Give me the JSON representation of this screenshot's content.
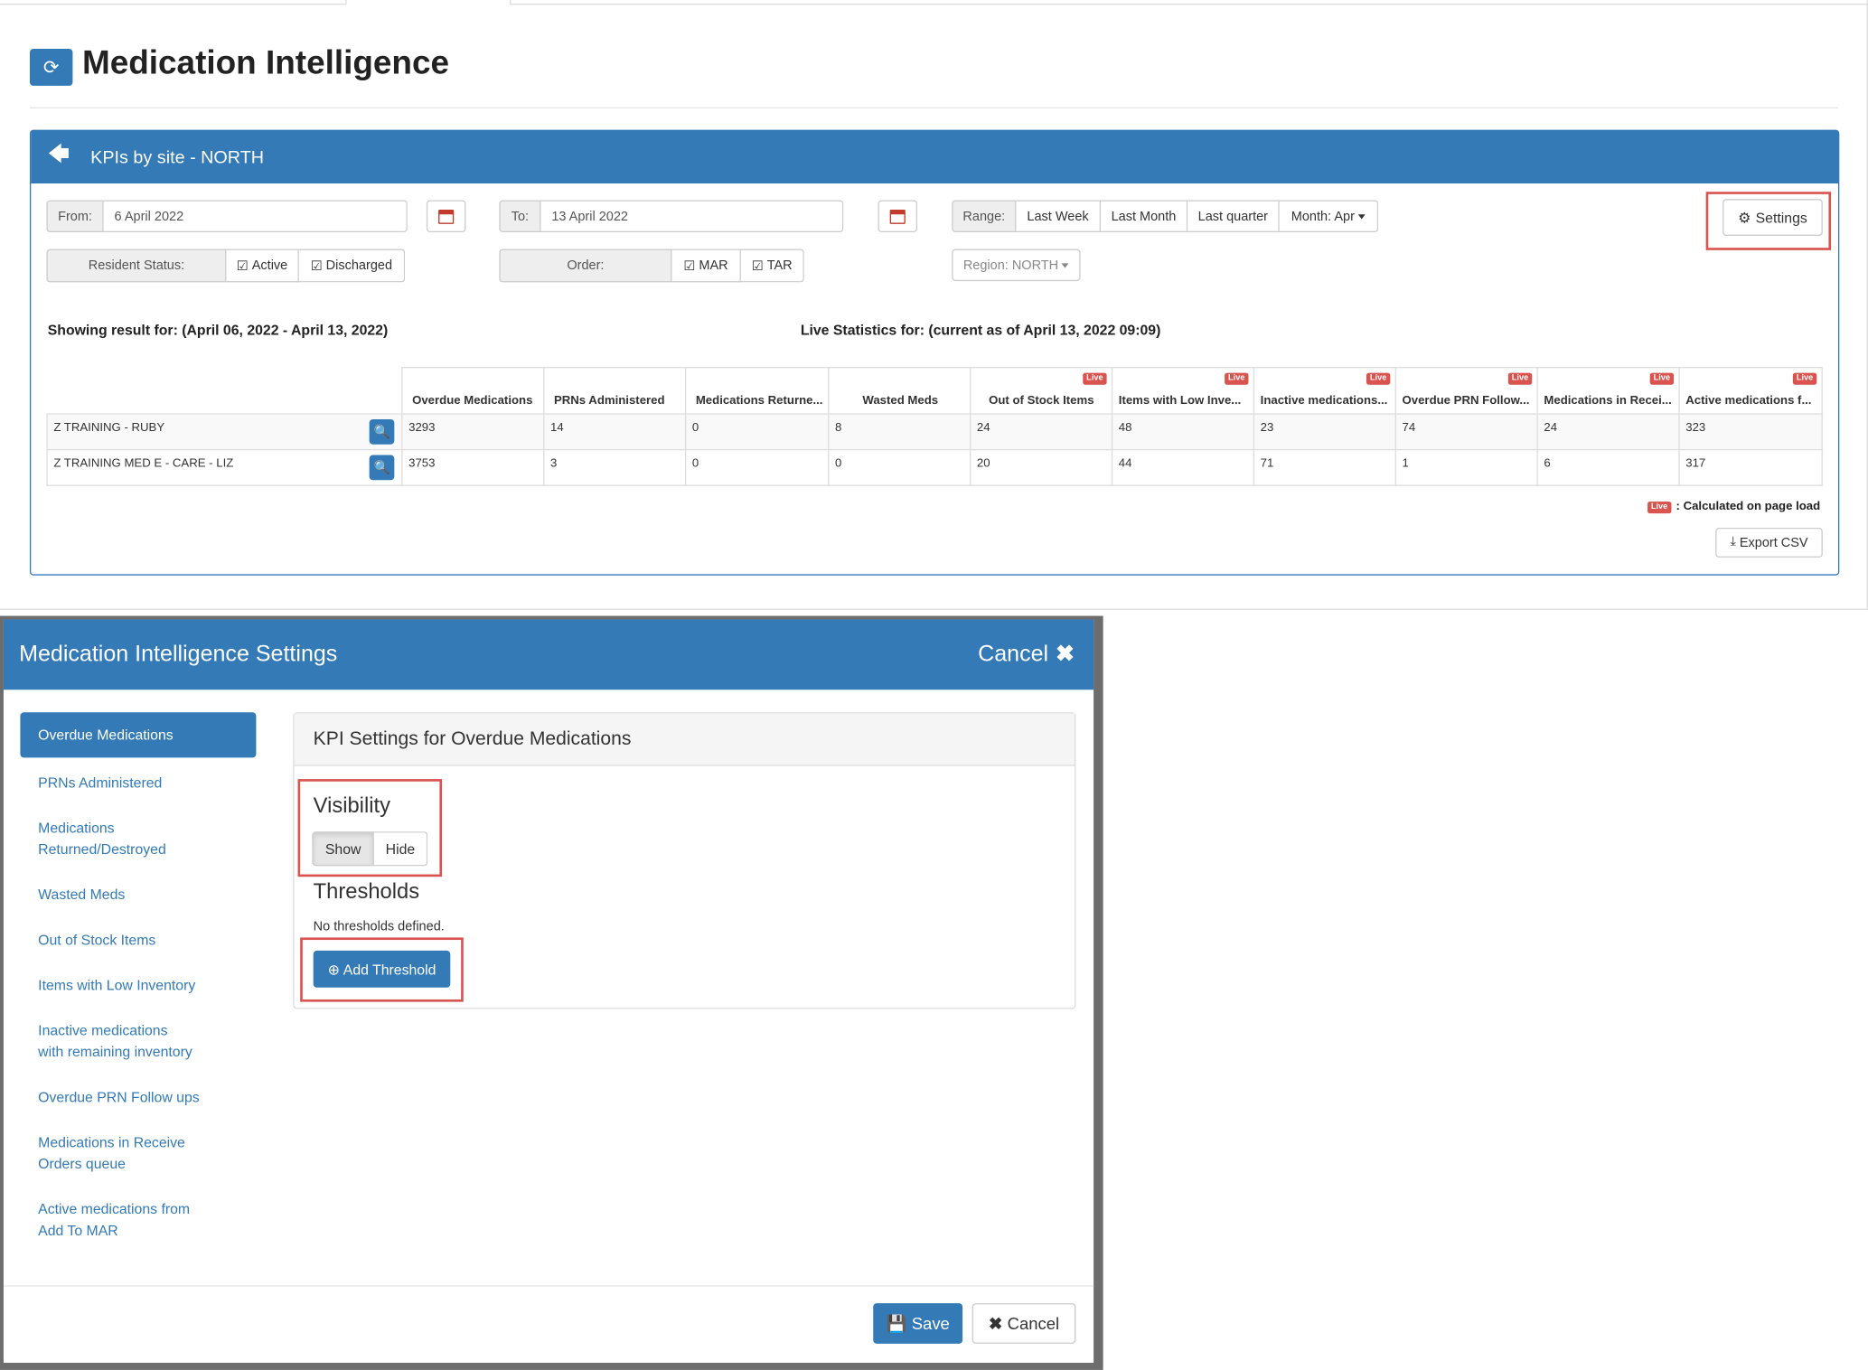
{
  "app": {
    "title": "Medication Intelligence",
    "panel_title": "KPIs by site - NORTH"
  },
  "filters": {
    "from_label": "From:",
    "from_value": "6 April 2022",
    "to_label": "To:",
    "to_value": "13 April 2022",
    "range_label": "Range:",
    "range_options": [
      "Last Week",
      "Last Month",
      "Last quarter",
      "Month: Apr"
    ],
    "resident_status_label": "Resident Status:",
    "resident_status_options": [
      "Active",
      "Discharged"
    ],
    "order_label": "Order:",
    "order_options": [
      "MAR",
      "TAR"
    ],
    "region": "Region: NORTH",
    "settings_label": "Settings"
  },
  "summary": {
    "showing": "Showing result for: (April 06, 2022 - April 13, 2022)",
    "live": "Live Statistics for: (current as of April 13, 2022 09:09)"
  },
  "table": {
    "headers": [
      "Overdue Medications",
      "PRNs Administered",
      "Medications Returne...",
      "Wasted Meds",
      "Out of Stock Items",
      "Items with Low Inve...",
      "Inactive medications...",
      "Overdue PRN Follow...",
      "Medications in Recei...",
      "Active medications f..."
    ],
    "live_badge": "Live",
    "rows": [
      {
        "site": "Z TRAINING - RUBY",
        "values": [
          "3293",
          "14",
          "0",
          "8",
          "24",
          "48",
          "23",
          "74",
          "24",
          "323"
        ]
      },
      {
        "site": "Z TRAINING MED E - CARE - LIZ",
        "values": [
          "3753",
          "3",
          "0",
          "0",
          "20",
          "44",
          "71",
          "1",
          "6",
          "317"
        ]
      }
    ]
  },
  "legend_text": ": Calculated on page load",
  "export_label": "Export CSV",
  "modal": {
    "title": "Medication Intelligence Settings",
    "cancel_top": "Cancel",
    "nav": [
      "Overdue Medications",
      "PRNs Administered",
      "Medications Returned/Destroyed",
      "Wasted Meds",
      "Out of Stock Items",
      "Items with Low Inventory",
      "Inactive medications with remaining inventory",
      "Overdue PRN Follow ups",
      "Medications in Receive Orders queue",
      "Active medications from Add To MAR"
    ],
    "panel_title": "KPI Settings for Overdue Medications",
    "visibility_title": "Visibility",
    "show_label": "Show",
    "hide_label": "Hide",
    "thresholds_title": "Thresholds",
    "no_thresholds": "No thresholds defined.",
    "add_threshold": "Add Threshold",
    "save_label": "Save",
    "cancel_label": "Cancel"
  },
  "colors": {
    "primary": "#337ab7",
    "danger": "#d9534f"
  }
}
